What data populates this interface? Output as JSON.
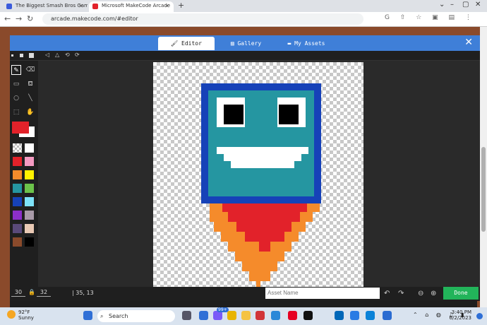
{
  "browser": {
    "tabs": [
      {
        "label": "The Biggest Smash Bros Game -",
        "active": false,
        "favicon_color": "#3b5bdb"
      },
      {
        "label": "Microsoft MakeCode Arcade",
        "active": true,
        "favicon_color": "#e2222a"
      }
    ],
    "new_tab_label": "+",
    "url": "arcade.makecode.com/#editor"
  },
  "header": {
    "tabs": [
      {
        "label": "Editor",
        "icon": "brush-icon",
        "active": true
      },
      {
        "label": "Gallery",
        "icon": "image-icon",
        "active": false
      },
      {
        "label": "My Assets",
        "icon": "folder-icon",
        "active": false
      }
    ],
    "close_icon": "close-icon",
    "accent": "#3f7fd8"
  },
  "palette": {
    "primary": "#e2222a",
    "secondary": "#ffffff",
    "colors": [
      "transparent",
      "#ffffff",
      "#e2222a",
      "#f49ac2",
      "#f58b2b",
      "#fff100",
      "#2596a1",
      "#6cc34a",
      "#1642b8",
      "#7ee2f8",
      "#8b2fc9",
      "#a89aa8",
      "#5a4a7a",
      "#e9c9b4",
      "#8a4a2b",
      "#000000"
    ]
  },
  "bottom": {
    "width": "30",
    "height": "32",
    "cursor": "35, 13",
    "asset_name_placeholder": "Asset Name",
    "done_label": "Done"
  },
  "taskbar": {
    "temp": "92°F",
    "condition": "Sunny",
    "search_placeholder": "Search",
    "time": "3:40 PM",
    "date": "6/2/2023",
    "badges": [
      "99+"
    ]
  }
}
